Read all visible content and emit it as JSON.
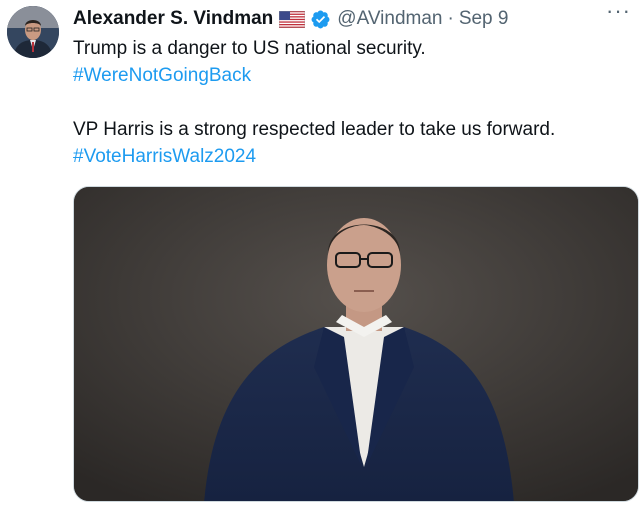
{
  "author": {
    "display_name": "Alexander S. Vindman",
    "handle": "@AVindman",
    "separator": "·",
    "date": "Sep 9",
    "flag_icon": "us-flag-icon",
    "verified_icon": "verified-badge-icon"
  },
  "more_label": "···",
  "body": {
    "line1": "Trump is a danger to US national security.",
    "hashtag1": "#WereNotGoingBack",
    "line2": "VP Harris is a strong respected leader to take us forward.",
    "hashtag2": "#VoteHarrisWalz2024"
  },
  "colors": {
    "text": "#0f1419",
    "secondary": "#536471",
    "link": "#1d9bf0",
    "verified": "#1d9bf0"
  }
}
